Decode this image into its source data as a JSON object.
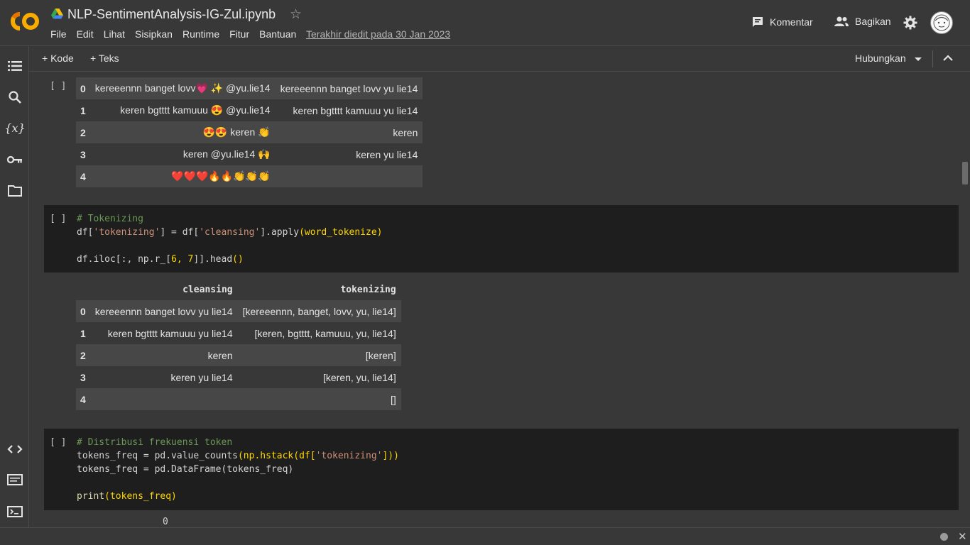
{
  "header": {
    "logo_text": "CO",
    "title": "NLP-SentimentAnalysis-IG-Zul.ipynb",
    "menu": [
      "File",
      "Edit",
      "Lihat",
      "Sisipkan",
      "Runtime",
      "Fitur",
      "Bantuan"
    ],
    "last_edit": "Terakhir diedit pada 30 Jan 2023",
    "comment_label": "Komentar",
    "share_label": "Bagikan"
  },
  "toolbar": {
    "add_code": "+ Kode",
    "add_text": "+ Teks",
    "connect": "Hubungkan"
  },
  "cell_prev": {
    "run": "[ ]",
    "rows": [
      {
        "idx": "0",
        "text": "kereeennn banget lovv💗 ✨ @yu.lie14",
        "clean": "kereeennn banget lovv yu lie14"
      },
      {
        "idx": "1",
        "text": "keren bgtttt kamuuu 😍 @yu.lie14",
        "clean": "keren bgtttt kamuuu yu lie14"
      },
      {
        "idx": "2",
        "text": "😍😍 keren 👏",
        "clean": "keren"
      },
      {
        "idx": "3",
        "text": "keren @yu.lie14 🙌",
        "clean": "keren yu lie14"
      },
      {
        "idx": "4",
        "text": "❤️❤️❤️🔥🔥👏👏👏",
        "clean": ""
      }
    ]
  },
  "cell_tokenize": {
    "run": "[ ]",
    "comment": "# Tokenizing",
    "line1_a": "df[",
    "line1_s1": "'tokenizing'",
    "line1_b": "] = df[",
    "line1_s2": "'cleansing'",
    "line1_c": "].apply",
    "line1_d": "(word_tokenize)",
    "line3_a": "df.iloc[:, np.r_[",
    "line3_b": "6, 7",
    "line3_c": "]].head",
    "line3_d": "()",
    "output": {
      "columns": [
        "cleansing",
        "tokenizing"
      ],
      "rows": [
        {
          "idx": "0",
          "cleansing": "kereeennn banget lovv yu lie14",
          "tokenizing": "[kereeennn, banget, lovv, yu, lie14]"
        },
        {
          "idx": "1",
          "cleansing": "keren bgtttt kamuuu yu lie14",
          "tokenizing": "[keren, bgtttt, kamuuu, yu, lie14]"
        },
        {
          "idx": "2",
          "cleansing": "keren",
          "tokenizing": "[keren]"
        },
        {
          "idx": "3",
          "cleansing": "keren yu lie14",
          "tokenizing": "[keren, yu, lie14]"
        },
        {
          "idx": "4",
          "cleansing": "",
          "tokenizing": "[]"
        }
      ]
    }
  },
  "cell_freq": {
    "run": "[ ]",
    "comment": "# Distribusi frekuensi token",
    "l1_a": "tokens_freq = pd.value_counts",
    "l1_b": "(np.hstack(df[",
    "l1_s": "'tokenizing'",
    "l1_c": "]))",
    "l2_a": "tokens_freq = pd.DataFrame",
    "l2_b": "(tokens_freq)",
    "l4_a": "print",
    "l4_b": "(tokens_freq)",
    "output_header": "0"
  },
  "colors": {
    "background": "#383838",
    "code_bg": "#1e1e1e",
    "table_stripe": "#474747",
    "comment": "#6a9955",
    "string": "#ce9178",
    "bracket": "#ffd700",
    "logo_orange": "#f9ab00"
  }
}
